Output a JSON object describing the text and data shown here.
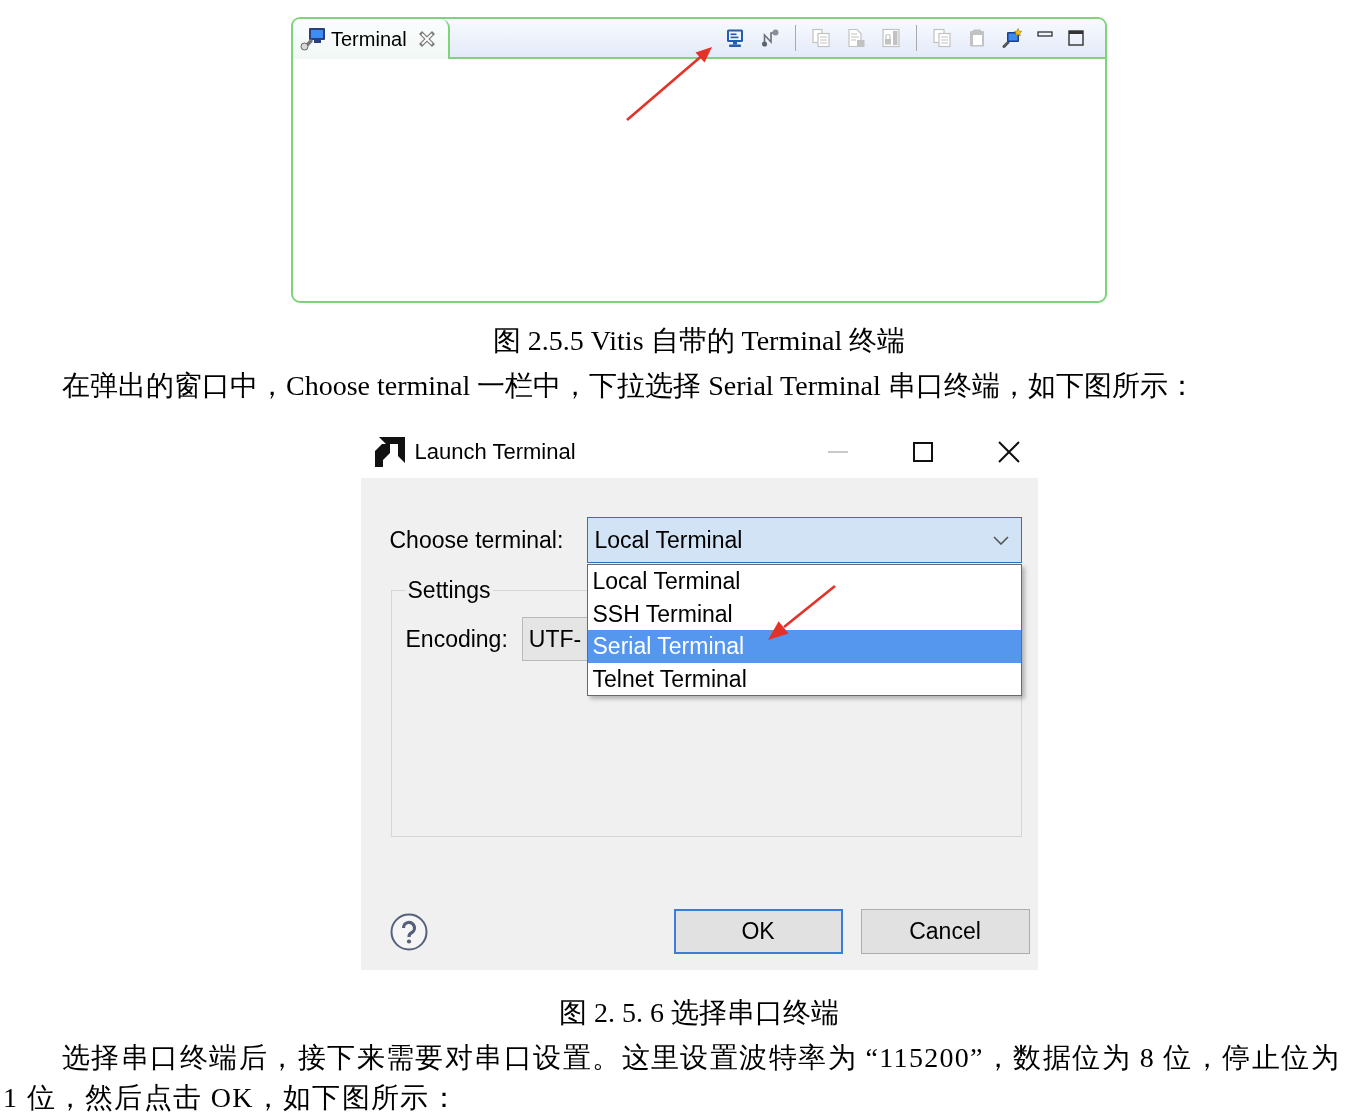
{
  "figure_1": {
    "view": {
      "tabs": [
        {
          "label": "Terminal",
          "selected": true
        }
      ],
      "toolbar_groups": [
        [
          {
            "kind": "monitor",
            "disabled": false
          },
          {
            "kind": "nodes",
            "disabled": false
          }
        ],
        [
          {
            "kind": "stack",
            "disabled": true
          },
          {
            "kind": "document",
            "disabled": true
          },
          {
            "kind": "panel",
            "disabled": true
          }
        ],
        [
          {
            "kind": "copy",
            "disabled": true
          },
          {
            "kind": "clipboard",
            "disabled": true
          },
          {
            "kind": "new_monitor",
            "disabled": false
          }
        ]
      ]
    },
    "caption": "图 2.5.5 Vitis 自带的 Terminal 终端"
  },
  "paragraph_1": "在弹出的窗口中，Choose terminal 一栏中，下拉选择 Serial Terminal 串口终端，如下图所示：",
  "figure_2": {
    "dialog": {
      "title": "Launch Terminal",
      "minimize_enabled": false,
      "terminal_label": "Choose terminal:",
      "terminal_value": "Local Terminal",
      "dropdown_expanded": true,
      "options": [
        {
          "label": "Local Terminal",
          "selected": false
        },
        {
          "label": "SSH Terminal",
          "selected": false
        },
        {
          "label": "Serial Terminal",
          "selected": true
        },
        {
          "label": "Telnet Terminal",
          "selected": false
        }
      ],
      "settings": {
        "title": "Settings",
        "encoding_label": "Encoding:",
        "encoding_value": "UTF-"
      },
      "buttons": [
        {
          "label": "OK",
          "default": true
        },
        {
          "label": "Cancel",
          "default": false
        }
      ]
    },
    "caption": "图 2. 5. 6 选择串口终端"
  },
  "paragraph_2": "选择串口终端后，接下来需要对串口设置。这里设置波特率为 “115200”，数据位为 8 位，停止位为 1 位，然后点击 OK，如下图所示："
}
